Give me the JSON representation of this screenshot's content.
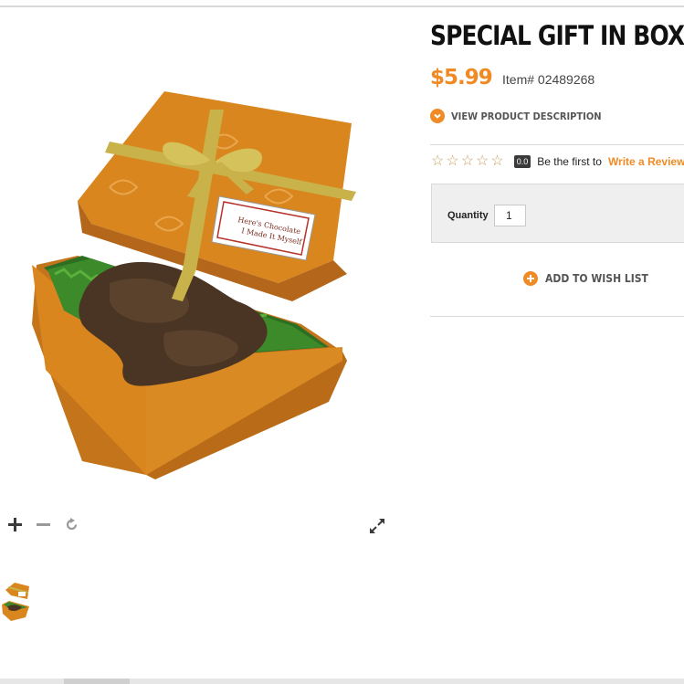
{
  "product": {
    "title": "SPECIAL GIFT IN BOX",
    "price": "$5.99",
    "item_number": "Item# 02489268",
    "view_description_label": "VIEW PRODUCT DESCRIPTION",
    "gift_tag_text": "To: Here's Chocolate I Made It Myself From:"
  },
  "rating": {
    "stars_filled": 0,
    "stars_total": 5,
    "score": "0.0",
    "first_text": "Be the first to",
    "write_review_label": "Write a Review"
  },
  "purchase": {
    "quantity_label": "Quantity",
    "quantity_value": "1",
    "wishlist_label": "ADD TO WISH LIST"
  },
  "image_controls": {
    "zoom_in_icon": "plus-icon",
    "zoom_out_icon": "minus-icon",
    "reset_icon": "rotate-icon",
    "fullscreen_icon": "expand-icon"
  },
  "colors": {
    "accent": "#f08a24",
    "box_orange": "#d9861f",
    "ribbon_gold": "#c9b24a",
    "grass_green": "#3c8a2a",
    "chocolate": "#4a3423"
  }
}
